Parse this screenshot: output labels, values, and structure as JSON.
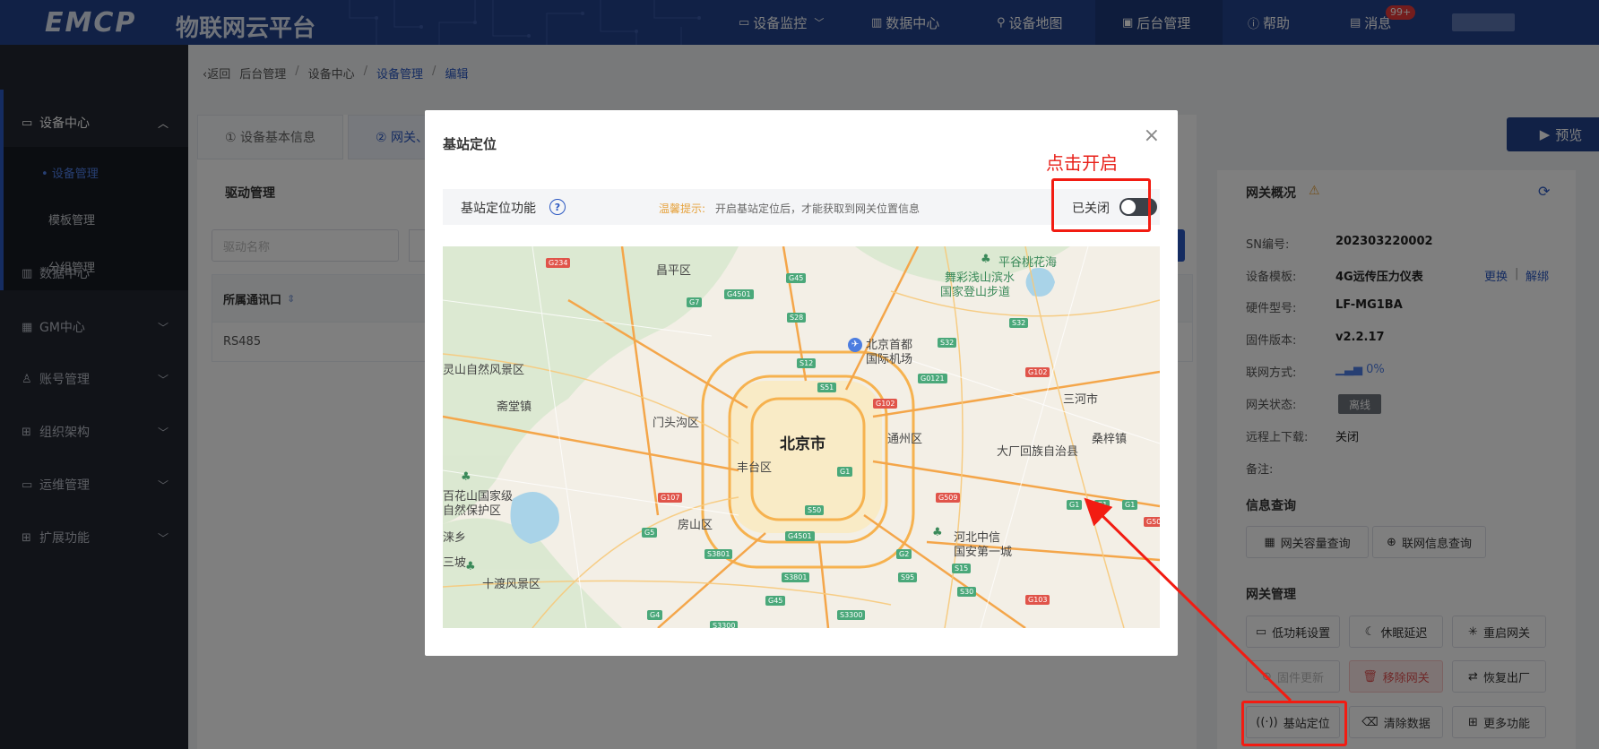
{
  "header": {
    "logo": "EMCP",
    "logo_sub": "物联网云平台",
    "nav": [
      {
        "label": "设备监控",
        "icon": "monitor-icon"
      },
      {
        "label": "数据中心",
        "icon": "chart-icon"
      },
      {
        "label": "设备地图",
        "icon": "map-pin-icon"
      },
      {
        "label": "后台管理",
        "icon": "admin-icon"
      },
      {
        "label": "帮助",
        "icon": "help-icon"
      },
      {
        "label": "消息",
        "icon": "message-icon"
      }
    ],
    "message_badge": "99+"
  },
  "sidebar": {
    "groups": [
      {
        "label": "设备中心"
      },
      {
        "label": "数据中心"
      },
      {
        "label": "GM中心"
      },
      {
        "label": "账号管理"
      },
      {
        "label": "组织架构"
      },
      {
        "label": "运维管理"
      },
      {
        "label": "扩展功能"
      }
    ],
    "sub_items": [
      {
        "label": "• 设备管理"
      },
      {
        "label": "模板管理"
      },
      {
        "label": "分组管理"
      }
    ]
  },
  "breadcrumb": {
    "back": "返回",
    "items": [
      "后台管理",
      "设备中心",
      "设备管理",
      "编辑"
    ]
  },
  "steps": [
    {
      "label": "① 设备基本信息"
    },
    {
      "label": "② 网关、"
    }
  ],
  "driver": {
    "title": "驱动管理",
    "search_placeholder": "驱动名称",
    "column_header": "所属通讯口",
    "rows": [
      "RS485"
    ]
  },
  "preview_label": "预览",
  "gateway": {
    "title": "网关概况",
    "fields": [
      {
        "label": "SN编号:",
        "value": "202303220002"
      },
      {
        "label": "设备模板:",
        "value": "4G远传压力仪表"
      },
      {
        "label": "硬件型号:",
        "value": "LF-MG1BA"
      },
      {
        "label": "固件版本:",
        "value": "v2.2.17"
      },
      {
        "label": "联网方式:",
        "value": "0%"
      },
      {
        "label": "网关状态:",
        "value": "离线"
      },
      {
        "label": "远程上下载:",
        "value": "关闭"
      },
      {
        "label": "备注:",
        "value": ""
      }
    ],
    "template_links": {
      "change": "更换",
      "sep": "|",
      "unbind": "解绑"
    },
    "info_section": "信息查询",
    "info_buttons": [
      "网关容量查询",
      "联网信息查询"
    ],
    "mgmt_section": "网关管理",
    "mgmt_buttons": [
      "低功耗设置",
      "休眠延迟",
      "重启网关",
      "固件更新",
      "移除网关",
      "恢复出厂",
      "基站定位",
      "清除数据",
      "更多功能"
    ]
  },
  "modal": {
    "title": "基站定位",
    "feature_label": "基站定位功能",
    "help_mark": "?",
    "tip_key": "温馨提示:",
    "tip_text": "开启基站定位后，才能获取到网关位置信息",
    "switch_label": "已关闭",
    "switch_on": false,
    "close_symbol": "×"
  },
  "map": {
    "labels": [
      "昌平区",
      "平谷桃花海",
      "舞彩浅山滨水",
      "国家登山步道",
      "北京首都",
      "国际机场",
      "灵山自然风景区",
      "斋堂镇",
      "门头沟区",
      "北京市",
      "通州区",
      "三河市",
      "大厂回族自治县",
      "桑梓镇",
      "丰台区",
      "百花山国家级",
      "自然保护区",
      "房山区",
      "涞乡",
      "三坡",
      "十渡风景区",
      "河北中信",
      "国安第一城"
    ],
    "shields": [
      {
        "text": "G234",
        "color": "r"
      },
      {
        "text": "G45",
        "color": "g"
      },
      {
        "text": "G4501",
        "color": "g"
      },
      {
        "text": "G7",
        "color": "g"
      },
      {
        "text": "S28",
        "color": "g"
      },
      {
        "text": "S32",
        "color": "g"
      },
      {
        "text": "S32",
        "color": "g"
      },
      {
        "text": "S12",
        "color": "g"
      },
      {
        "text": "G0121",
        "color": "g"
      },
      {
        "text": "G102",
        "color": "r"
      },
      {
        "text": "S51",
        "color": "g"
      },
      {
        "text": "G102",
        "color": "r"
      },
      {
        "text": "G1",
        "color": "g"
      },
      {
        "text": "G107",
        "color": "r"
      },
      {
        "text": "G509",
        "color": "r"
      },
      {
        "text": "G1",
        "color": "g"
      },
      {
        "text": "G1",
        "color": "g"
      },
      {
        "text": "G1",
        "color": "g"
      },
      {
        "text": "S50",
        "color": "g"
      },
      {
        "text": "G5",
        "color": "g"
      },
      {
        "text": "G4501",
        "color": "g"
      },
      {
        "text": "S3801",
        "color": "g"
      },
      {
        "text": "G2",
        "color": "g"
      },
      {
        "text": "S15",
        "color": "g"
      },
      {
        "text": "S95",
        "color": "g"
      },
      {
        "text": "S3801",
        "color": "g"
      },
      {
        "text": "G45",
        "color": "g"
      },
      {
        "text": "S30",
        "color": "g"
      },
      {
        "text": "G103",
        "color": "r"
      },
      {
        "text": "G4",
        "color": "g"
      },
      {
        "text": "S3300",
        "color": "g"
      },
      {
        "text": "S3300",
        "color": "g"
      },
      {
        "text": "G50",
        "color": "r"
      }
    ]
  },
  "annotation": {
    "note": "点击开启"
  },
  "colors": {
    "header_bg": "#23428d",
    "sidebar_bg": "#222731",
    "accent": "#2b58c2",
    "annotation_red": "#f21c12"
  }
}
